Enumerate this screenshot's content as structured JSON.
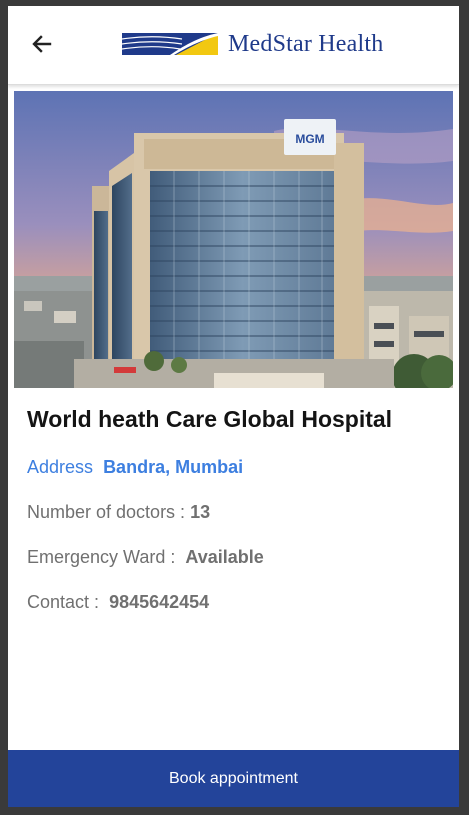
{
  "header": {
    "back_icon": "arrow-left-icon",
    "logo_text": "MedStar Health",
    "logo_colors": {
      "navy": "#1f3a8a",
      "gold": "#f2c811"
    }
  },
  "hospital": {
    "image_sign": "MGM",
    "name": "World heath Care Global Hospital",
    "address_label": "Address",
    "address_value": "Bandra, Mumbai",
    "doctors_label": "Number of doctors :",
    "doctors_value": "13",
    "emergency_label": "Emergency Ward :",
    "emergency_value": "Available",
    "contact_label": "Contact :",
    "contact_value": "9845642454"
  },
  "actions": {
    "book_label": "Book appointment"
  },
  "colors": {
    "primary": "#23449a",
    "link": "#3d7fe0",
    "muted": "#707070"
  }
}
